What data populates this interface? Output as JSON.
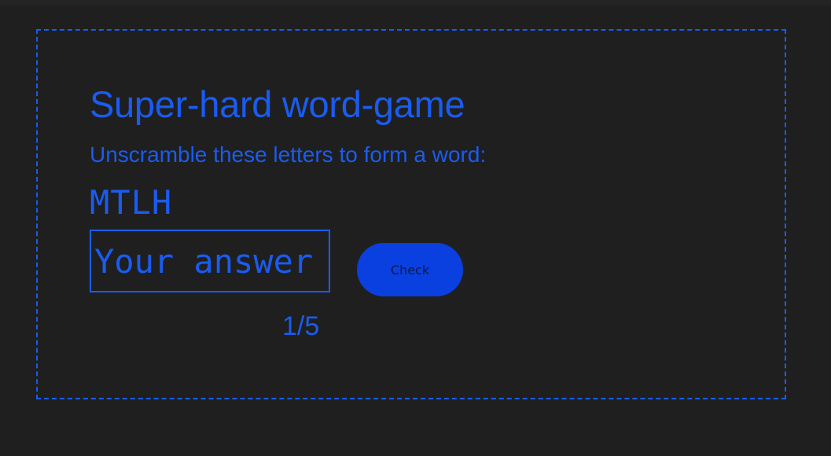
{
  "game": {
    "title": "Super-hard word-game",
    "instructions": "Unscramble these letters to form a word:",
    "scrambled_letters": "MTLH",
    "answer_input": {
      "value": "",
      "placeholder": "Your answer"
    },
    "check_button_label": "Check",
    "progress": "1/5",
    "colors": {
      "background": "#1f1f1f",
      "accent": "#1a5cf0",
      "button": "#0a40e0",
      "button_text": "#0b1a4a"
    }
  }
}
